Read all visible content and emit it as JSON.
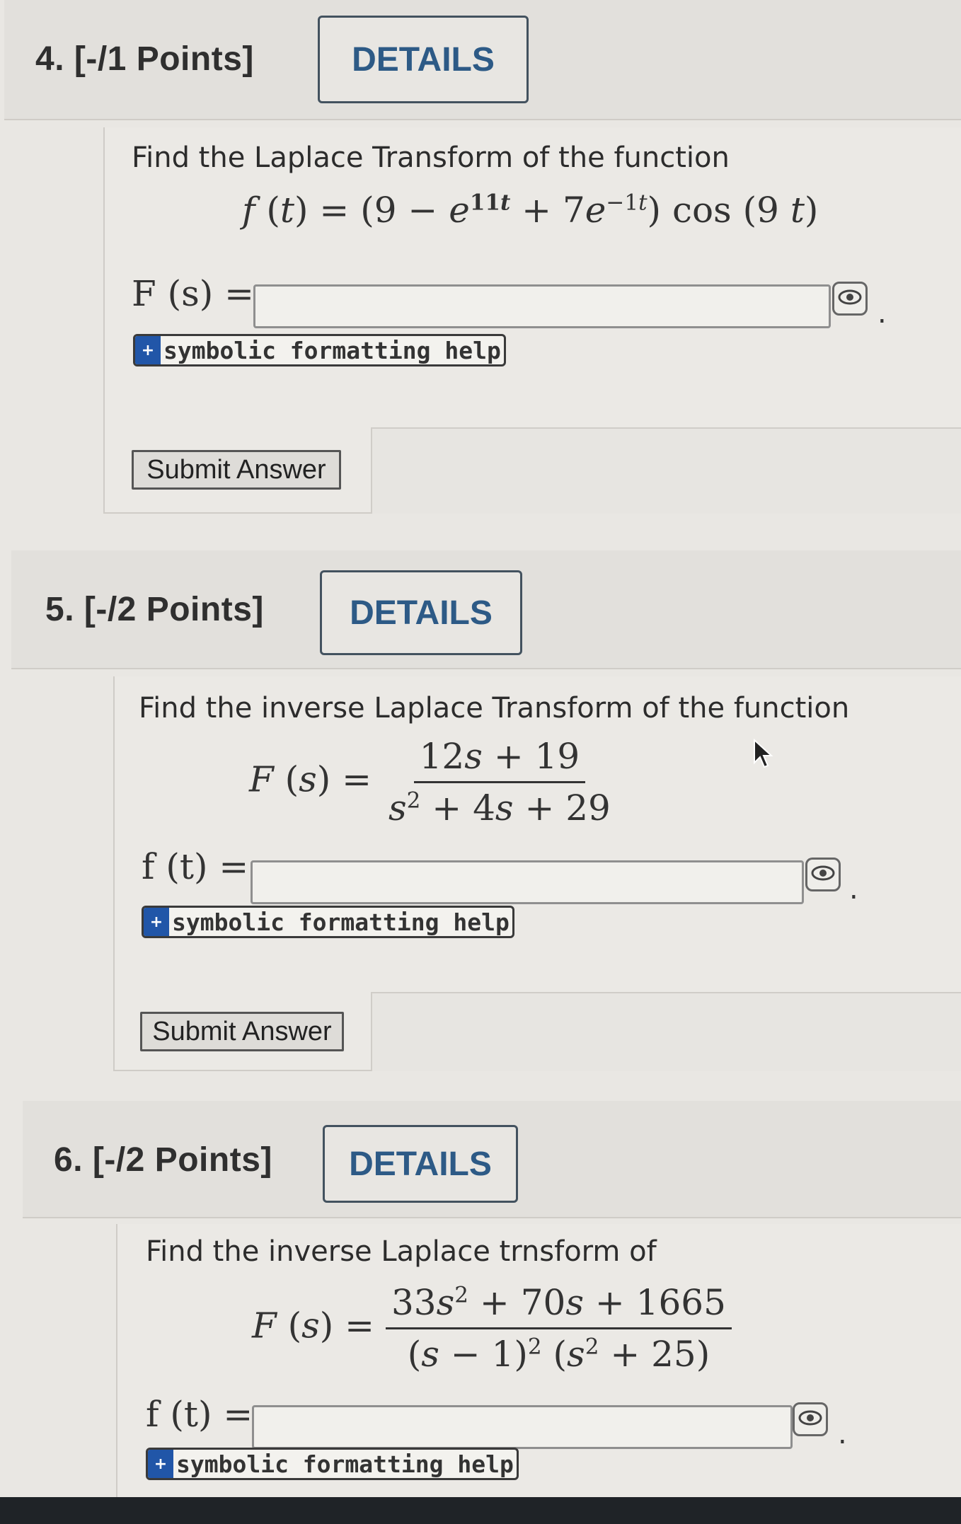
{
  "questions": [
    {
      "number": "4.",
      "points": "[-/1 Points]",
      "details_label": "DETAILS",
      "prompt": "Find the Laplace Transform of the function",
      "answer_label": "F (s) =",
      "answer_value": "",
      "help_label": "symbolic formatting help",
      "submit_label": "Submit Answer"
    },
    {
      "number": "5.",
      "points": "[-/2 Points]",
      "details_label": "DETAILS",
      "prompt": "Find the inverse Laplace Transform of the function",
      "answer_label": "f (t) =",
      "answer_value": "",
      "help_label": "symbolic formatting help",
      "submit_label": "Submit Answer"
    },
    {
      "number": "6.",
      "points": "[-/2 Points]",
      "details_label": "DETAILS",
      "prompt": "Find the inverse Laplace trnsform of",
      "answer_label": "f (t) =",
      "answer_value": "",
      "help_label": "symbolic formatting help"
    }
  ],
  "icons": {
    "preview": "eye-icon",
    "help": "symbol-keyboard-icon",
    "cursor": "mouse-pointer-icon"
  },
  "colors": {
    "details_text": "#2d5a86",
    "help_icon_bg": "#2156a8"
  }
}
